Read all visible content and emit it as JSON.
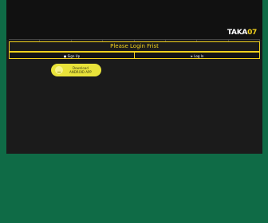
{
  "brand": {
    "logo_text": "TAKA",
    "logo_number": "07",
    "accent": "#f3d21c"
  },
  "notice": {
    "text": "Please Login Frist"
  },
  "auth": {
    "signup_label": "Sign Up",
    "login_label": "Log In"
  },
  "download": {
    "line1": "Download",
    "line2": "ANDROID APP"
  },
  "colors": {
    "background": "#0f6b46",
    "panel": "#1b1b1b",
    "button": "#e9e33a"
  }
}
